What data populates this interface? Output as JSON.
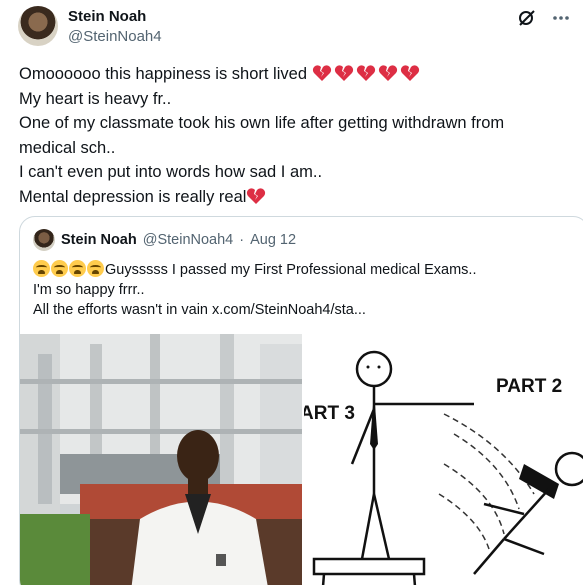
{
  "author": {
    "name": "Stein Noah",
    "handle": "@SteinNoah4"
  },
  "header_icons": [
    "grok-icon",
    "more-options-icon"
  ],
  "tweet": {
    "lines": [
      "Omoooooo this happiness is short lived",
      "My heart is heavy fr..",
      "One of my classmate took his own life after getting withdrawn from",
      "medical sch..",
      "I can't even put into words how sad I am..",
      "Mental depression is really real"
    ],
    "line1_emoji": "broken-heart x5",
    "line6_emoji": "broken-heart"
  },
  "quoted": {
    "name": "Stein Noah",
    "handle": "@SteinNoah4",
    "separator": "·",
    "date": "Aug 12",
    "line1_emoji": "loudly-crying-face x4",
    "line1": "Guysssss I passed my First Professional medical Exams..",
    "line2": "I'm so happy frrr..",
    "line3": "All the efforts wasn't in vain  x.com/SteinNoah4/sta..."
  },
  "media": {
    "photo": "man in white lab coat in front of building",
    "cartoon_labels": [
      "ART 3",
      "PART 2"
    ]
  },
  "colors": {
    "text": "#0f1419",
    "secondary": "#536471",
    "border": "#cfd9de",
    "broken_heart": "#dd2e44"
  }
}
